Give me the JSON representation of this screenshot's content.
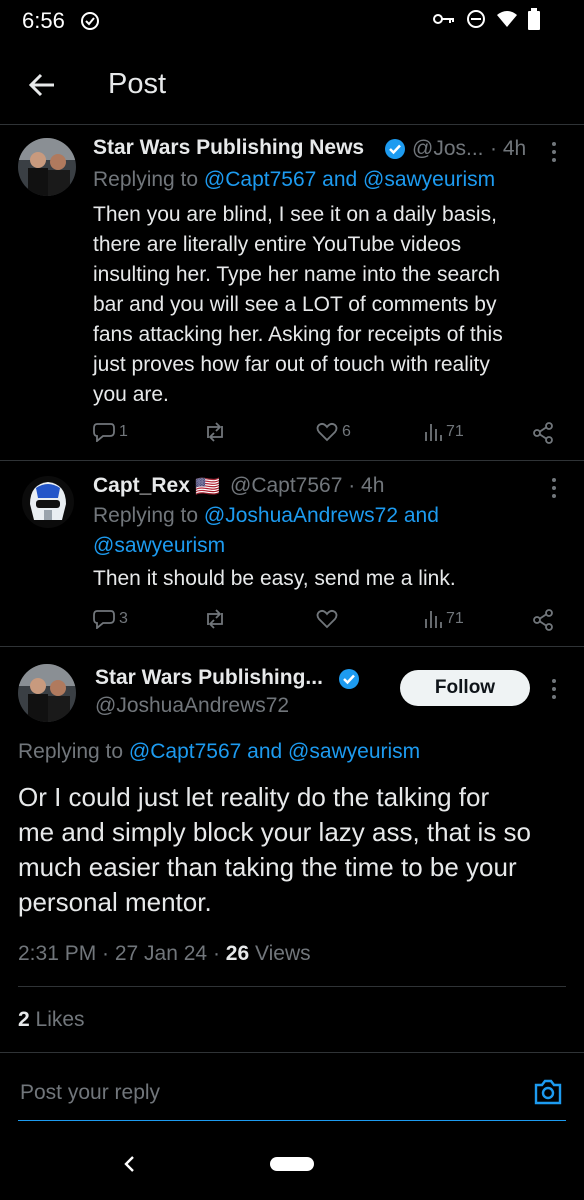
{
  "status_bar": {
    "time": "6:56"
  },
  "header": {
    "title": "Post"
  },
  "replies": [
    {
      "name": "Star Wars Publishing News",
      "handle": "@Jos...",
      "time": "· 4h",
      "replying_prefix": "Replying to ",
      "replying_to": "@Capt7567 and @sawyeurism",
      "text_lines": [
        "Then you are blind, I see it on a daily basis,",
        "there are literally entire YouTube videos",
        "insulting her. Type her name into the search",
        "bar and you will see a LOT of comments by",
        "fans attacking her. Asking for receipts of this",
        "just proves how far out of touch with reality",
        "you are."
      ],
      "replies_count": "1",
      "likes_count": "6",
      "views_count": "71"
    },
    {
      "name": "Capt_Rex",
      "flag": "🇺🇸",
      "handle": "@Capt7567 · 4h",
      "replying_prefix": "Replying to ",
      "replying_to_line1": "@JoshuaAndrews72 and",
      "replying_to_line2": "@sawyeurism",
      "text": "Then it should be easy, send me a link.",
      "replies_count": "3",
      "likes_count": "",
      "views_count": "71"
    }
  ],
  "main_post": {
    "name": "Star Wars Publishing...",
    "handle": "@JoshuaAndrews72",
    "follow_label": "Follow",
    "replying_prefix": "Replying to ",
    "replying_to": "@Capt7567 and @sawyeurism",
    "text_lines": [
      "Or I could just let reality do the talking for",
      "me and simply block your lazy ass, that is so",
      "much easier than taking the time to be your",
      "personal mentor."
    ],
    "meta_time": "2:31 PM · 27 Jan 24 · ",
    "views_number": "26",
    "views_label": " Views",
    "likes_number": "2",
    "likes_label": " Likes"
  },
  "reply_box": {
    "placeholder": "Post your reply"
  },
  "colors": {
    "accent": "#1d9bf0",
    "muted": "#71767b",
    "text": "#e7e9ea",
    "bg": "#000000"
  }
}
